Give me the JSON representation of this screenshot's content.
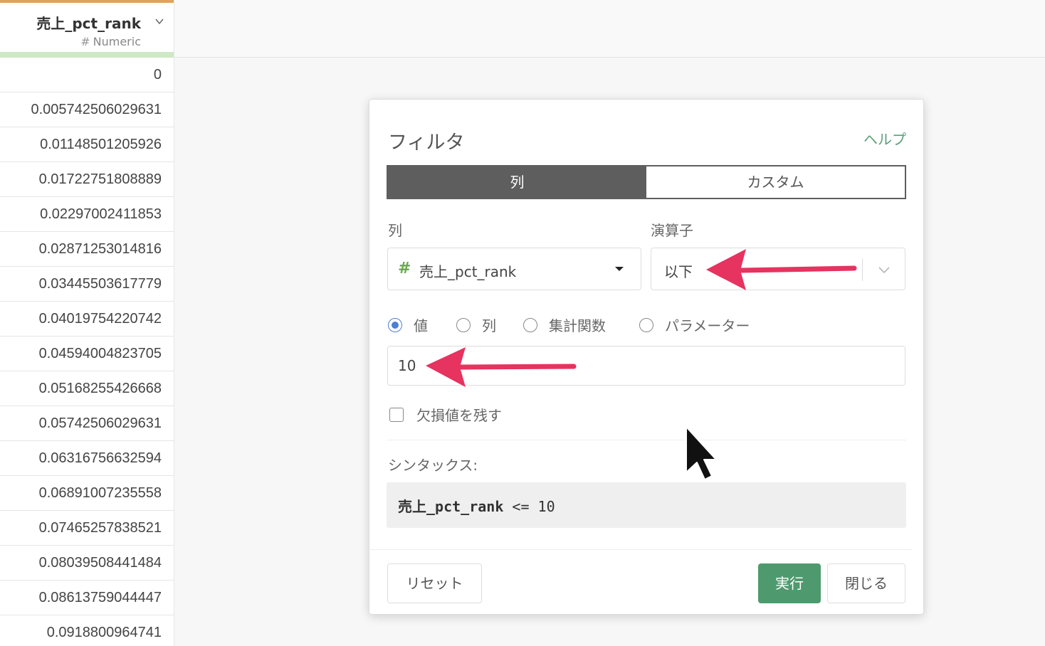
{
  "column": {
    "name": "売上_pct_rank",
    "type_hash": "#",
    "type_label": "Numeric",
    "values": [
      "0",
      "0.00574250602963​1",
      "0.01148501205926",
      "0.01722751808889",
      "0.02297002411853",
      "0.02871253014816",
      "0.03445503617779",
      "0.04019754220742",
      "0.04594004823705",
      "0.05168255426668",
      "0.05742506029631",
      "0.06316756632594",
      "0.06891007235558",
      "0.07465257838521",
      "0.08039508441484",
      "0.08613759044447",
      "0.0918800964741"
    ]
  },
  "dialog": {
    "title": "フィルタ",
    "help": "ヘルプ",
    "tabs": [
      "列",
      "カスタム"
    ],
    "column_label": "列",
    "operator_label": "演算子",
    "column_hash": "#",
    "column_value": "売上_pct_rank",
    "operator_value": "以下",
    "radio_options": [
      "値",
      "列",
      "集計関数",
      "パラメーター"
    ],
    "selected_radio": 0,
    "value_input": "10",
    "keep_missing_label": "欠損値を残す",
    "syntax_label": "シンタックス:",
    "syntax_column": "売上_pct_rank",
    "syntax_rest": " <= 10",
    "buttons": {
      "reset": "リセット",
      "run": "実行",
      "close": "閉じる"
    }
  },
  "colors": {
    "accent_green": "#4e9a6e",
    "header_orange": "#e1a35b",
    "annotation_arrow": "#e6335f",
    "radio_blue": "#4a7fd6"
  }
}
